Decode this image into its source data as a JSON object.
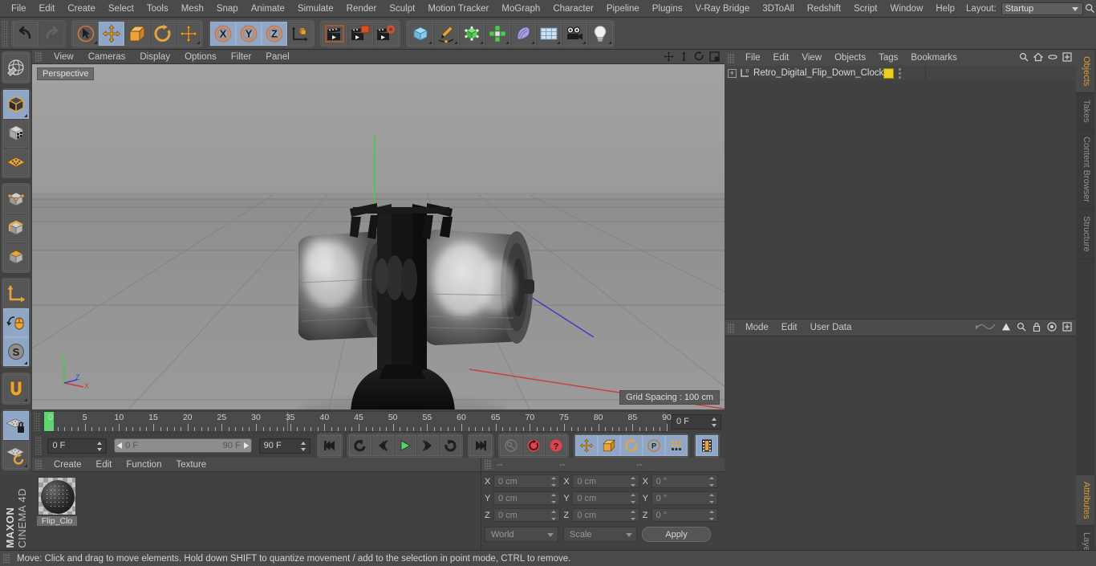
{
  "app": {
    "name": "MAXON CINEMA 4D",
    "brand_bold": "MAXON",
    "brand_light": "CINEMA 4D"
  },
  "menubar": {
    "items": [
      "File",
      "Edit",
      "Create",
      "Select",
      "Tools",
      "Mesh",
      "Snap",
      "Animate",
      "Simulate",
      "Render",
      "Sculpt",
      "Motion Tracker",
      "MoGraph",
      "Character",
      "Pipeline",
      "Plugins",
      "V-Ray Bridge",
      "3DToAll",
      "Redshift",
      "Script",
      "Window",
      "Help"
    ],
    "layout_label": "Layout:",
    "layout_value": "Startup",
    "search_icon": "magnifier-icon"
  },
  "toolbar": {
    "groups": [
      {
        "name": "history",
        "buttons": [
          {
            "name": "undo-button",
            "icon": "undo-arrow-icon",
            "active": false,
            "dim": false
          },
          {
            "name": "redo-button",
            "icon": "redo-arrow-icon",
            "active": false,
            "dim": true
          }
        ]
      },
      {
        "name": "transform-tools",
        "buttons": [
          {
            "name": "live-selection-tool",
            "icon": "cursor-circle-icon",
            "active": false,
            "dim": false
          },
          {
            "name": "move-tool",
            "icon": "move-cross-icon",
            "active": true,
            "dim": false
          },
          {
            "name": "scale-tool",
            "icon": "scale-box-icon",
            "active": false,
            "dim": false
          },
          {
            "name": "rotate-tool",
            "icon": "rotate-arc-icon",
            "active": false,
            "dim": false
          },
          {
            "name": "move-duplicate-tool",
            "icon": "move-cross-icon",
            "active": false,
            "dim": false
          }
        ]
      },
      {
        "name": "axis-locks",
        "buttons": [
          {
            "name": "lock-x-axis",
            "icon": "x-axis-icon",
            "active": true,
            "dim": false
          },
          {
            "name": "lock-y-axis",
            "icon": "y-axis-icon",
            "active": true,
            "dim": false
          },
          {
            "name": "lock-z-axis",
            "icon": "z-axis-icon",
            "active": true,
            "dim": false
          },
          {
            "name": "world-object-coordinates",
            "icon": "world-axis-cube-icon",
            "active": false,
            "dim": false
          }
        ]
      },
      {
        "name": "render-tools",
        "buttons": [
          {
            "name": "render-view-button",
            "icon": "clapperboard-icon",
            "active": false,
            "dim": false
          },
          {
            "name": "render-to-picture-viewer-button",
            "icon": "clapperboard-window-icon",
            "active": false,
            "dim": false
          },
          {
            "name": "render-settings-button",
            "icon": "clapperboard-gear-icon",
            "active": false,
            "dim": false
          }
        ]
      },
      {
        "name": "create-objects",
        "buttons": [
          {
            "name": "add-cube-button",
            "icon": "blue-cube-icon",
            "active": false,
            "dim": false
          },
          {
            "name": "add-spline-button",
            "icon": "pen-spline-icon",
            "active": false,
            "dim": false
          },
          {
            "name": "add-generator-button",
            "icon": "green-cube-icon",
            "active": false,
            "dim": false
          },
          {
            "name": "add-mograph-button",
            "icon": "green-cluster-icon",
            "active": false,
            "dim": false
          },
          {
            "name": "add-deformer-button",
            "icon": "purple-bend-icon",
            "active": false,
            "dim": false
          },
          {
            "name": "add-environment-button",
            "icon": "floor-grid-icon",
            "active": false,
            "dim": false
          },
          {
            "name": "add-camera-button",
            "icon": "camera-icon",
            "active": false,
            "dim": false
          },
          {
            "name": "add-light-button",
            "icon": "lightbulb-icon",
            "active": false,
            "dim": false
          }
        ]
      }
    ]
  },
  "leftbar": {
    "groups": [
      {
        "buttons": [
          {
            "name": "make-editable-button",
            "icon": "editable-globe-icon",
            "active": false
          }
        ]
      },
      {
        "buttons": [
          {
            "name": "model-mode-button",
            "icon": "model-cube-icon",
            "active": true
          },
          {
            "name": "texture-mode-button",
            "icon": "texture-cube-icon",
            "active": false
          },
          {
            "name": "workplane-mode-button",
            "icon": "workplane-grid-icon",
            "active": false
          }
        ]
      },
      {
        "buttons": [
          {
            "name": "points-mode-button",
            "icon": "points-cube-icon",
            "active": false
          },
          {
            "name": "edges-mode-button",
            "icon": "edges-cube-icon",
            "active": false
          },
          {
            "name": "polygons-mode-button",
            "icon": "polygons-cube-icon",
            "active": false
          }
        ]
      },
      {
        "buttons": [
          {
            "name": "object-axis-mode-button",
            "icon": "axis-corner-icon",
            "active": false
          },
          {
            "name": "viewport-solo-button",
            "icon": "mouse-icon",
            "active": true
          },
          {
            "name": "enable-snapping-button",
            "icon": "snap-s-icon",
            "active": true
          }
        ]
      },
      {
        "buttons": [
          {
            "name": "magnet-tool-button",
            "icon": "magnet-icon",
            "active": false
          }
        ]
      },
      {
        "buttons": [
          {
            "name": "lock-workplane-button",
            "icon": "workplane-lock-icon",
            "active": true
          },
          {
            "name": "planar-workplane-button",
            "icon": "workplane-rotate-icon",
            "active": false
          }
        ]
      }
    ]
  },
  "viewport": {
    "menu": [
      "View",
      "Cameras",
      "Display",
      "Options",
      "Filter",
      "Panel"
    ],
    "view_label": "Perspective",
    "grid_spacing": "Grid Spacing : 100 cm",
    "nav_icons": [
      "pan-icon",
      "dolly-icon",
      "orbit-icon",
      "maximize-icon"
    ],
    "axis_gizmo": {
      "y": "Y",
      "x": "X",
      "z": "Z",
      "y_color": "#3ecf3e",
      "x_color": "#d04040",
      "z_color": "#4040d0"
    }
  },
  "timeline": {
    "start": 0,
    "end": 90,
    "current_frame": 0,
    "ticks": [
      0,
      5,
      10,
      15,
      20,
      25,
      30,
      35,
      40,
      45,
      50,
      55,
      60,
      65,
      70,
      75,
      80,
      85,
      90
    ],
    "frame_field_right": "0 F",
    "current_field": "0 F",
    "range_start": "0 F",
    "range_end": "90 F",
    "end_field": "90 F",
    "transport": [
      {
        "name": "go-to-start-button",
        "icon": "skip-start-icon",
        "active": false
      },
      {
        "name": "play-backwards-button",
        "icon": "loop-back-icon",
        "active": false
      },
      {
        "name": "previous-frame-button",
        "icon": "step-back-icon",
        "active": false
      },
      {
        "name": "play-button",
        "icon": "play-triangle-icon",
        "active": false
      },
      {
        "name": "next-frame-button",
        "icon": "step-forward-icon",
        "active": false
      },
      {
        "name": "play-forwards-loop-button",
        "icon": "loop-forward-icon",
        "active": false
      },
      {
        "name": "go-to-end-button",
        "icon": "skip-end-icon",
        "active": false
      }
    ],
    "keyframe_tools": [
      {
        "name": "record-active-objects-button",
        "icon": "key-icon",
        "active": false
      },
      {
        "name": "autokeying-button",
        "icon": "red-circle-icon",
        "active": false
      },
      {
        "name": "keyframe-selection-button",
        "icon": "red-question-icon",
        "active": false
      }
    ],
    "key_filters": [
      {
        "name": "position-key-button",
        "icon": "move-cross-icon",
        "active": true
      },
      {
        "name": "scale-key-button",
        "icon": "scale-box-icon",
        "active": true
      },
      {
        "name": "rotation-key-button",
        "icon": "rotate-arc-icon",
        "active": true
      },
      {
        "name": "parameter-key-button",
        "icon": "p-circle-icon",
        "active": true
      },
      {
        "name": "point-level-animation-button",
        "icon": "dots-grid-icon",
        "active": true
      }
    ],
    "timeline_toggle": {
      "name": "timeline-button",
      "icon": "film-strip-icon",
      "active": true
    }
  },
  "material_manager": {
    "menu": [
      "Create",
      "Edit",
      "Function",
      "Texture"
    ],
    "materials": [
      {
        "name": "Flip_Clo",
        "icon": "material-sphere-icon"
      }
    ]
  },
  "coordinates": {
    "headers": [
      "--",
      "--",
      "--"
    ],
    "position": {
      "label_x": "X",
      "label_y": "Y",
      "label_z": "Z",
      "x": "0 cm",
      "y": "0 cm",
      "z": "0 cm"
    },
    "size": {
      "label_x": "X",
      "label_y": "Y",
      "label_z": "Z",
      "x": "0 cm",
      "y": "0 cm",
      "z": "0 cm"
    },
    "rotation": {
      "label_x": "X",
      "label_y": "Y",
      "label_z": "Z",
      "x": "0 °",
      "y": "0 °",
      "z": "0 °"
    },
    "system": "World",
    "mode": "Scale",
    "apply_label": "Apply"
  },
  "object_manager": {
    "menu": [
      "File",
      "Edit",
      "View",
      "Objects",
      "Tags",
      "Bookmarks"
    ],
    "icons": [
      "search-icon",
      "home-icon",
      "ellipse-icon",
      "plus-box-icon"
    ],
    "objects": [
      {
        "name": "Retro_Digital_Flip_Down_Clock",
        "icon": "null-object-icon",
        "tag_color": "#e8d021"
      }
    ]
  },
  "attribute_manager": {
    "menu": [
      "Mode",
      "Edit",
      "User Data"
    ],
    "icons": [
      "wave-icon",
      "arrow-up-icon",
      "search-icon",
      "lock-icon",
      "target-icon",
      "plus-box-icon"
    ]
  },
  "edge_tabs": {
    "upper": [
      {
        "label": "Objects",
        "active": true
      },
      {
        "label": "Takes",
        "active": false
      },
      {
        "label": "Content Browser",
        "active": false
      },
      {
        "label": "Structure",
        "active": false
      }
    ],
    "lower": [
      {
        "label": "Attributes",
        "active": true
      },
      {
        "label": "Layers",
        "active": false
      }
    ]
  },
  "statusbar": {
    "text": "Move: Click and drag to move elements. Hold down SHIFT to quantize movement / add to the selection in point mode, CTRL to remove."
  }
}
